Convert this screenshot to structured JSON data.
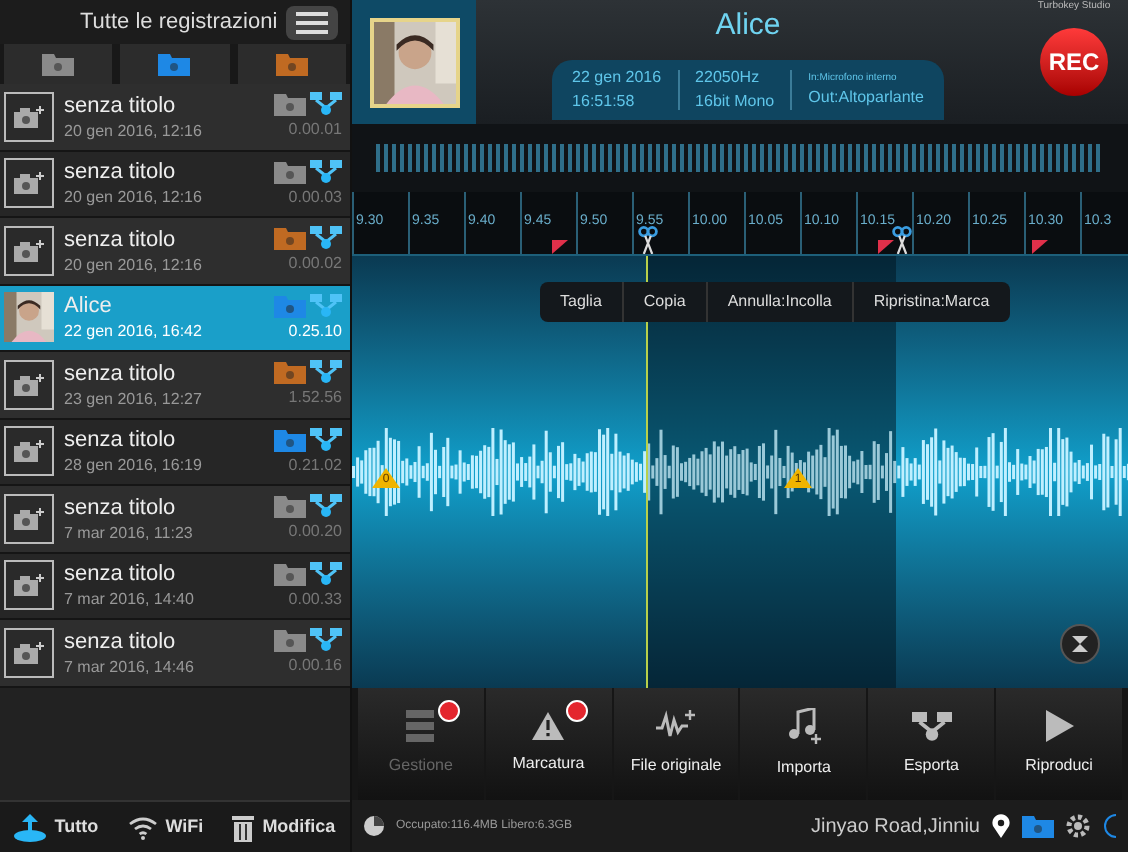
{
  "sidebar": {
    "title": "Tutte le registrazioni",
    "folder_tabs": [
      {
        "color": "#8a8a8a"
      },
      {
        "color": "#1e88e5"
      },
      {
        "color": "#c06a22"
      }
    ],
    "items": [
      {
        "kind": "placeholder",
        "title": "senza titolo",
        "date": "20 gen 2016, 12:16",
        "duration": "0.00.01",
        "color": "#8a8a8a",
        "selected": false
      },
      {
        "kind": "placeholder",
        "title": "senza titolo",
        "date": "20 gen 2016, 12:16",
        "duration": "0.00.03",
        "color": "#8a8a8a",
        "selected": false
      },
      {
        "kind": "placeholder",
        "title": "senza titolo",
        "date": "20 gen 2016, 12:16",
        "duration": "0.00.02",
        "color": "#c06a22",
        "selected": false
      },
      {
        "title": "Alice",
        "date": "22 gen 2016, 16:42",
        "duration": "0.25.10",
        "color": "#1e88e5",
        "selected": true
      },
      {
        "kind": "placeholder",
        "title": "senza titolo",
        "date": "23 gen 2016, 12:27",
        "duration": "1.52.56",
        "color": "#c06a22",
        "selected": false
      },
      {
        "kind": "placeholder",
        "title": "senza titolo",
        "date": "28 gen 2016, 16:19",
        "duration": "0.21.02",
        "color": "#1e88e5",
        "selected": false
      },
      {
        "kind": "placeholder",
        "title": "senza titolo",
        "date": "7 mar 2016, 11:23",
        "duration": "0.00.20",
        "color": "#8a8a8a",
        "selected": false
      },
      {
        "kind": "placeholder",
        "title": "senza titolo",
        "date": "7 mar 2016, 14:40",
        "duration": "0.00.33",
        "color": "#8a8a8a",
        "selected": false
      },
      {
        "kind": "placeholder",
        "title": "senza titolo",
        "date": "7 mar 2016, 14:46",
        "duration": "0.00.16",
        "color": "#8a8a8a",
        "selected": false
      }
    ],
    "bottom_bar": [
      {
        "kind": "upload",
        "label": "Tutto"
      },
      {
        "kind": "wifi",
        "label": "WiFi"
      },
      {
        "kind": "trash",
        "label": "Modifica"
      }
    ]
  },
  "header": {
    "brand": "Turbokey Studio",
    "title": "Alice",
    "date": "22 gen 2016",
    "time": "16:51:58",
    "rate": "22050Hz",
    "format": "16bit Mono",
    "input": "In:Microfono interno",
    "output": "Out:Altoparlante",
    "rec": "REC"
  },
  "timeline": [
    "9.30",
    "9.35",
    "9.40",
    "9.45",
    "9.50",
    "9.55",
    "10.00",
    "10.05",
    "10.10",
    "10.15",
    "10.20",
    "10.25",
    "10.30",
    "10.3"
  ],
  "context_menu": [
    "Taglia",
    "Copia",
    "Annulla:Incolla",
    "Ripristina:Marca"
  ],
  "markers": [
    {
      "label": "0"
    },
    {
      "label": "1"
    }
  ],
  "toolbar": [
    {
      "kind": "server",
      "label": "Gestione",
      "disabled": true,
      "badge": true
    },
    {
      "kind": "warning",
      "label": "Marcatura",
      "disabled": false,
      "badge": true
    },
    {
      "kind": "wave",
      "label": "File originale",
      "disabled": false,
      "badge": false
    },
    {
      "kind": "music",
      "label": "Importa",
      "disabled": false,
      "badge": false
    },
    {
      "kind": "share",
      "label": "Esporta",
      "disabled": false,
      "badge": false
    },
    {
      "kind": "play",
      "label": "Riproduci",
      "disabled": false,
      "badge": false
    }
  ],
  "status_bar": {
    "storage": "Occupato:116.4MB Libero:6.3GB",
    "location": "Jinyao Road,Jinniu"
  }
}
